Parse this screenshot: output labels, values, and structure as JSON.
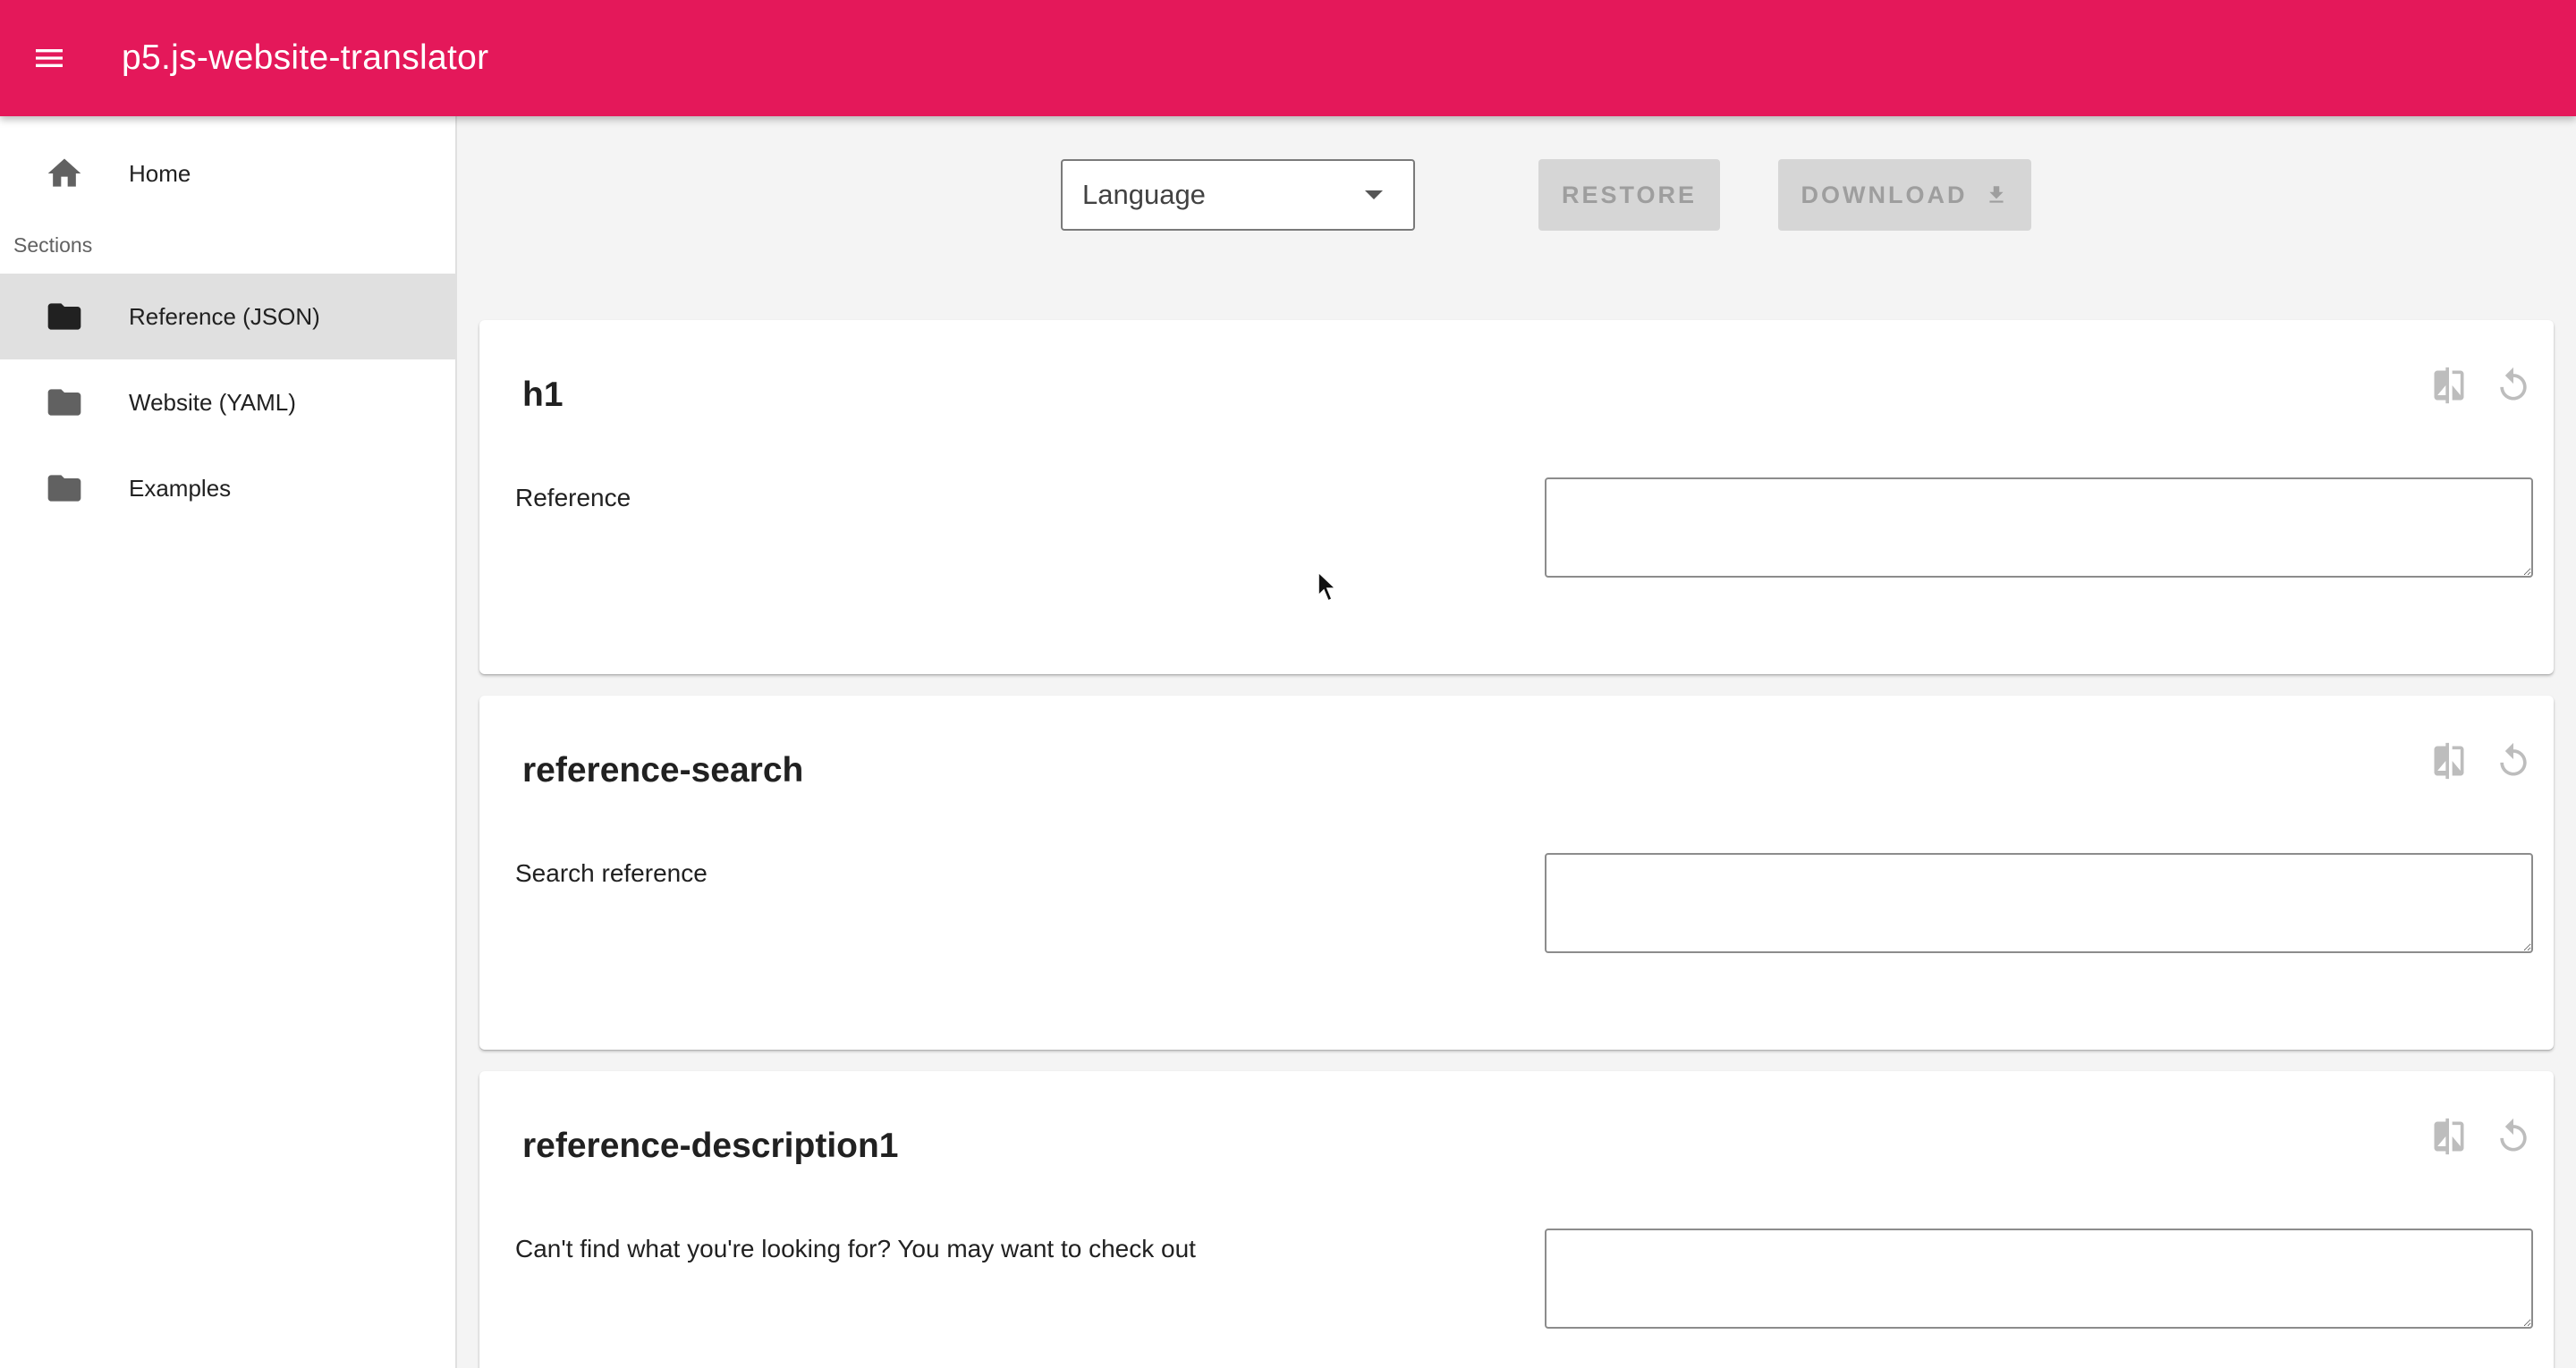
{
  "app": {
    "title": "p5.js-website-translator",
    "accent_color": "#e4185a"
  },
  "sidebar": {
    "home_label": "Home",
    "sections_label": "Sections",
    "items": [
      {
        "label": "Reference (JSON)",
        "icon": "folder-icon",
        "active": true
      },
      {
        "label": "Website (YAML)",
        "icon": "folder-icon",
        "active": false
      },
      {
        "label": "Examples",
        "icon": "folder-icon",
        "active": false
      }
    ]
  },
  "toolbar": {
    "language_select": {
      "selected": "Language"
    },
    "restore_label": "RESTORE",
    "download_label": "DOWNLOAD",
    "download_icon": "download-icon"
  },
  "cards": [
    {
      "key": "h1",
      "reference": "Reference",
      "value": ""
    },
    {
      "key": "reference-search",
      "reference": "Search reference",
      "value": ""
    },
    {
      "key": "reference-description1",
      "reference": "Can't find what you're looking for? You may want to check out",
      "value": ""
    }
  ],
  "card_icons": [
    "compare-icon",
    "restore-icon"
  ]
}
